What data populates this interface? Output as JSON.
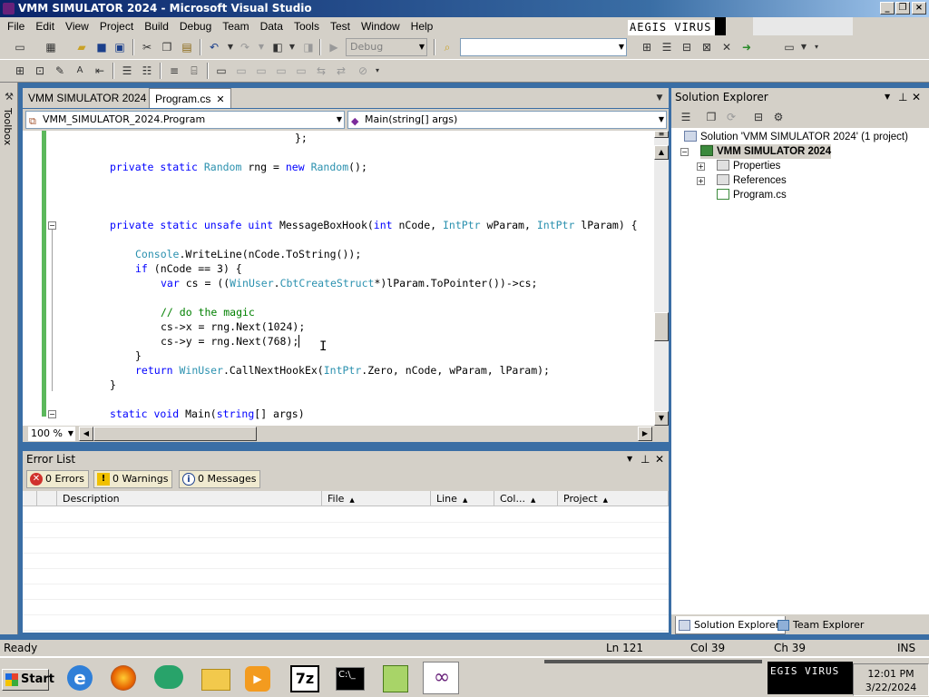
{
  "window": {
    "title": "VMM SIMULATOR 2024 - Microsoft Visual Studio"
  },
  "menu": [
    "File",
    "Edit",
    "View",
    "Project",
    "Build",
    "Debug",
    "Team",
    "Data",
    "Tools",
    "Test",
    "Window",
    "Help"
  ],
  "toolbar": {
    "config_combo": "Debug",
    "search_combo": ""
  },
  "overlay_text": {
    "top": "AEGIS VIRUS",
    "taskbar": "EGIS VIRUS"
  },
  "toolbox": {
    "label": "Toolbox"
  },
  "tabs": {
    "project": "VMM SIMULATOR 2024",
    "active_file": "Program.cs"
  },
  "navbar": {
    "class_combo": "VMM_SIMULATOR_2024.Program",
    "member_combo": "Main(string[] args)"
  },
  "code": {
    "l1": "};",
    "l2a": "private static ",
    "l2b": "Random",
    "l2c": " rng = ",
    "l2d": "new ",
    "l2e": "Random",
    "l2f": "();",
    "l3a": "private static unsafe uint ",
    "l3b": "MessageBoxHook(",
    "l3c": "int ",
    "l3d": "nCode, ",
    "l3e": "IntPtr",
    "l3f": " wParam, ",
    "l3g": "IntPtr",
    "l3h": " lParam) {",
    "l4a": "Console",
    "l4b": ".WriteLine(nCode.ToString());",
    "l5a": "if ",
    "l5b": "(nCode == 3) {",
    "l6a": "var ",
    "l6b": "cs = ((",
    "l6c": "WinUser",
    "l6d": ".",
    "l6e": "CbtCreateStruct",
    "l6f": "*)lParam.ToPointer())->cs;",
    "l7": "// do the magic",
    "l8": "cs->x = rng.Next(1024);",
    "l9": "cs->y = rng.Next(768);",
    "l10": "}",
    "l11a": "return ",
    "l11b": "WinUser",
    "l11c": ".CallNextHookEx(",
    "l11d": "IntPtr",
    "l11e": ".Zero, nCode, wParam, lParam);",
    "l12": "}",
    "l13a": "static void ",
    "l13b": "Main(",
    "l13c": "string",
    "l13d": "[] args)"
  },
  "zoom": "100 %",
  "error_list": {
    "title": "Error List",
    "errors": "0 Errors",
    "warnings": "0 Warnings",
    "messages": "0 Messages",
    "columns": [
      "Description",
      "File",
      "Line",
      "Col...",
      "Project"
    ]
  },
  "solution_explorer": {
    "title": "Solution Explorer",
    "solution": "Solution 'VMM SIMULATOR 2024' (1 project)",
    "project": "VMM SIMULATOR 2024",
    "items": [
      "Properties",
      "References",
      "Program.cs"
    ],
    "tab_solution": "Solution Explorer",
    "tab_team": "Team Explorer"
  },
  "status": {
    "ready": "Ready",
    "ln": "Ln 121",
    "col": "Col 39",
    "ch": "Ch 39",
    "mode": "INS"
  },
  "taskbar": {
    "start": "Start",
    "time": "12:01 PM",
    "date": "3/22/2024",
    "app7z": "7z"
  }
}
